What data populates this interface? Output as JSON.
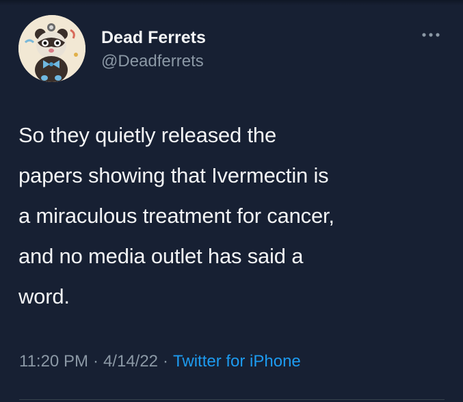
{
  "tweet": {
    "author": {
      "display_name": "Dead Ferrets",
      "handle": "@Deadferrets",
      "avatar_icon": "ferret-avatar-icon"
    },
    "more_icon": "more-options-icon",
    "text_lines": [
      "So they quietly released the",
      "papers showing that Ivermectin is",
      "a miraculous treatment for cancer,",
      "and no media outlet has said a",
      "word."
    ],
    "meta": {
      "time": "11:20 PM",
      "date": "4/14/22",
      "separator": "·",
      "client": "Twitter for iPhone"
    }
  },
  "colors": {
    "background": "#172033",
    "text_primary": "#f3f4f5",
    "text_secondary": "#8b98a5",
    "link": "#1d9bf0"
  }
}
